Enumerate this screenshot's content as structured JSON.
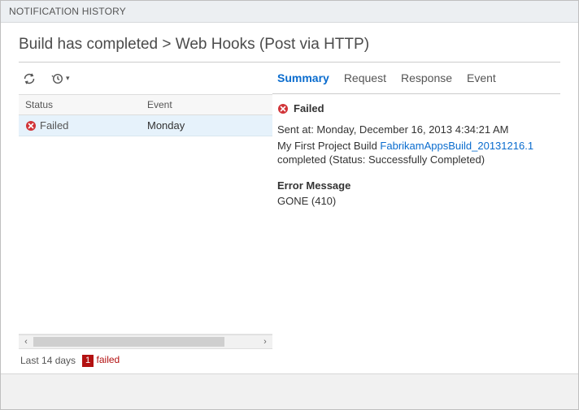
{
  "window": {
    "title": "NOTIFICATION HISTORY"
  },
  "heading": "Build has completed > Web Hooks (Post via HTTP)",
  "toolbar": {
    "refresh_title": "Refresh",
    "history_title": "History range"
  },
  "grid": {
    "columns": {
      "status": "Status",
      "event": "Event"
    },
    "rows": [
      {
        "status": "Failed",
        "event": "Monday"
      }
    ]
  },
  "footer": {
    "range": "Last 14 days",
    "failed_count": "1",
    "failed_word": "failed"
  },
  "tabs": {
    "summary": "Summary",
    "request": "Request",
    "response": "Response",
    "event": "Event"
  },
  "detail": {
    "status_label": "Failed",
    "sent_line": "Sent at: Monday, December 16, 2013 4:34:21 AM",
    "build_prefix": "My First Project Build ",
    "build_link": "FabrikamAppsBuild_20131216.1",
    "build_suffix": " completed (Status: Successfully Completed)",
    "error_heading": "Error Message",
    "error_body": "GONE (410)"
  }
}
